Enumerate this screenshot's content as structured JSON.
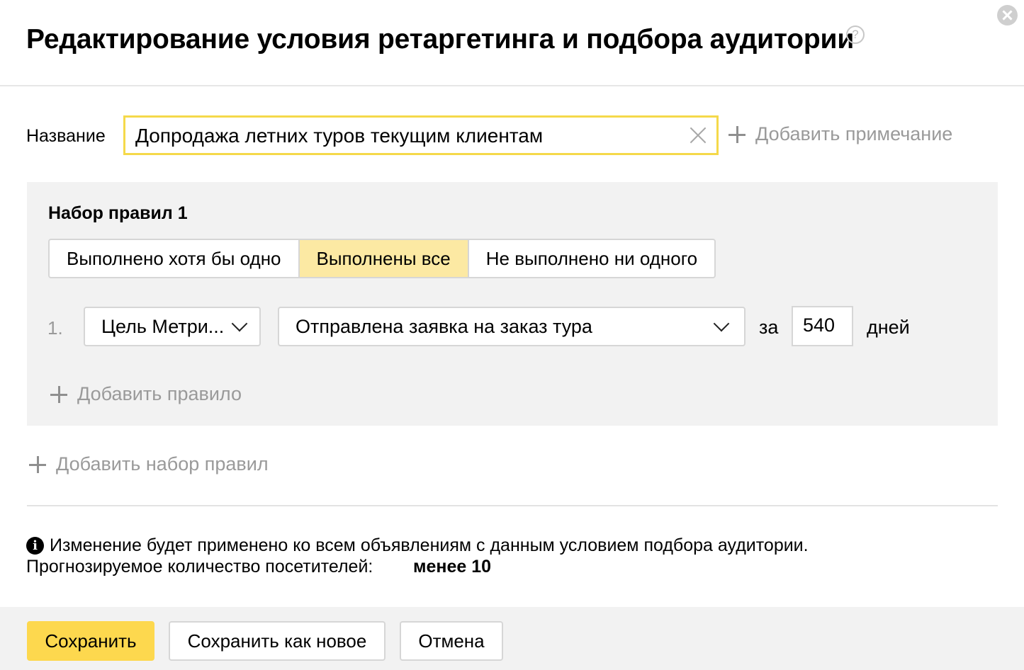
{
  "dialog": {
    "title": "Редактирование условия ретаргетинга и подбора аудитории",
    "help_icon": "?"
  },
  "name_field": {
    "label": "Название",
    "value": "Допродажа летних туров текущим клиентам"
  },
  "add_note_label": "Добавить примечание",
  "ruleset": {
    "title": "Набор правил  1",
    "modes": [
      "Выполнено хотя бы одно",
      "Выполнены все",
      "Не выполнено ни одного"
    ],
    "selected_mode": "Выполнены все",
    "rules": [
      {
        "number": "1.",
        "type": "Цель Метри...",
        "goal": "Отправлена заявка на заказ тура",
        "period_prefix": "за",
        "days": "540",
        "days_label": "дней"
      }
    ],
    "add_rule_label": "Добавить правило"
  },
  "add_ruleset_label": "Добавить набор правил",
  "info": {
    "message": "Изменение будет применено ко всем объявлениям с данным условием подбора аудитории.",
    "forecast_label": "Прогнозируемое количество посетителей:",
    "forecast_value": "менее 10"
  },
  "footer": {
    "save_label": "Сохранить",
    "save_as_new_label": "Сохранить как новое",
    "cancel_label": "Отмена"
  },
  "colors": {
    "accent": "#fdd84e",
    "active_segment": "#fce9a3",
    "input_focus_border": "#f5d94a",
    "panel_background": "#f2f2f2",
    "muted_text": "#9a9a9a"
  },
  "icons": [
    "help-icon",
    "close-icon",
    "clear-icon",
    "plus-icon",
    "chevron-down-icon",
    "info-icon"
  ]
}
